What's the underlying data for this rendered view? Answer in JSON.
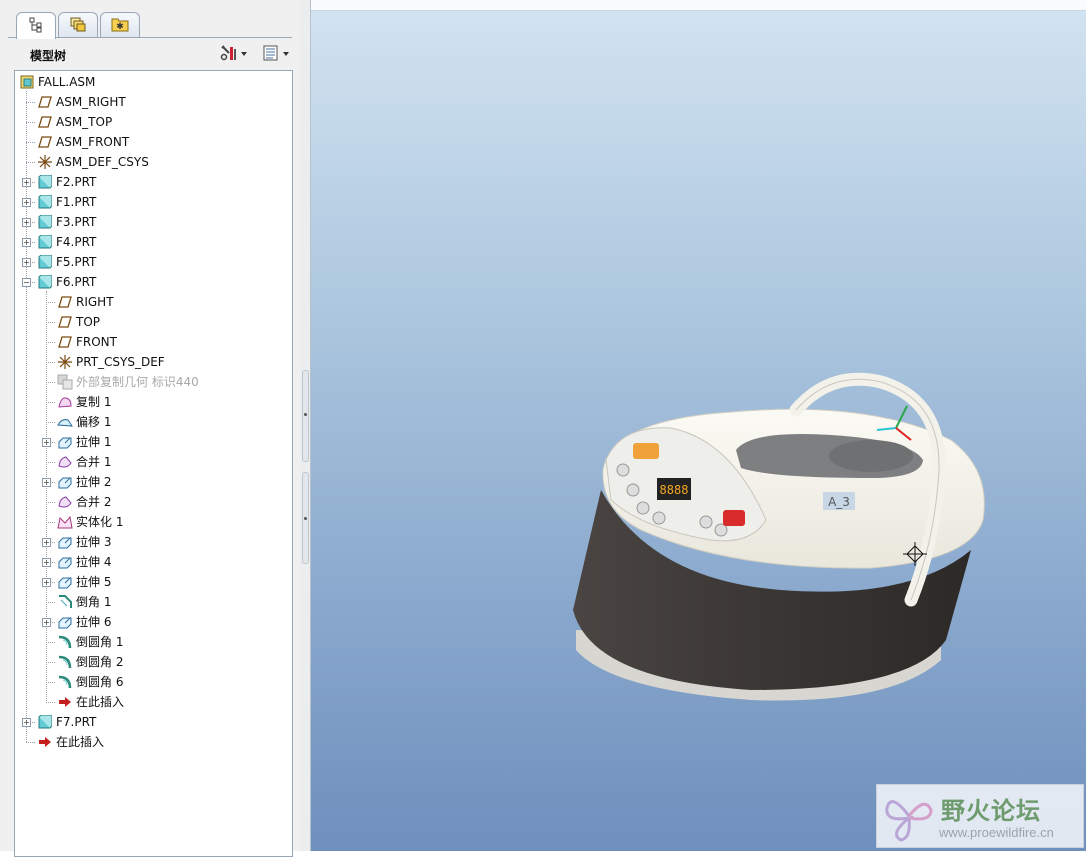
{
  "panel": {
    "tabs": [
      {
        "name": "model-tree",
        "icon": "model-tree-icon",
        "active": true
      },
      {
        "name": "layers",
        "icon": "layers-icon",
        "active": false
      },
      {
        "name": "favorites",
        "icon": "favorites-folder-icon",
        "active": false
      }
    ],
    "title": "模型树",
    "settings_icon": "tools-icon",
    "show_icon": "list-view-icon"
  },
  "tree": {
    "root": {
      "label": "FALL.ASM",
      "icon": "assembly-icon"
    },
    "items": [
      {
        "label": "ASM_RIGHT",
        "icon": "datum-plane-icon"
      },
      {
        "label": "ASM_TOP",
        "icon": "datum-plane-icon"
      },
      {
        "label": "ASM_FRONT",
        "icon": "datum-plane-icon"
      },
      {
        "label": "ASM_DEF_CSYS",
        "icon": "coordinate-system-icon"
      },
      {
        "label": "F2.PRT",
        "icon": "part-icon",
        "expandable": true,
        "expanded": false
      },
      {
        "label": "F1.PRT",
        "icon": "part-icon",
        "expandable": true,
        "expanded": false
      },
      {
        "label": "F3.PRT",
        "icon": "part-icon",
        "expandable": true,
        "expanded": false
      },
      {
        "label": "F4.PRT",
        "icon": "part-icon",
        "expandable": true,
        "expanded": false
      },
      {
        "label": "F5.PRT",
        "icon": "part-icon",
        "expandable": true,
        "expanded": false
      },
      {
        "label": "F6.PRT",
        "icon": "part-icon",
        "expandable": true,
        "expanded": true
      }
    ],
    "f6_children": [
      {
        "label": "RIGHT",
        "icon": "datum-plane-icon"
      },
      {
        "label": "TOP",
        "icon": "datum-plane-icon"
      },
      {
        "label": "FRONT",
        "icon": "datum-plane-icon"
      },
      {
        "label": "PRT_CSYS_DEF",
        "icon": "coordinate-system-icon"
      },
      {
        "label": "外部复制几何 标识440",
        "icon": "external-copy-geometry-icon",
        "disabled": true
      },
      {
        "label": "复制 1",
        "icon": "copy-surface-icon"
      },
      {
        "label": "偏移 1",
        "icon": "offset-icon"
      },
      {
        "label": "拉伸 1",
        "icon": "extrude-icon",
        "expandable": true
      },
      {
        "label": "合并 1",
        "icon": "merge-icon"
      },
      {
        "label": "拉伸 2",
        "icon": "extrude-icon",
        "expandable": true
      },
      {
        "label": "合并 2",
        "icon": "merge-icon"
      },
      {
        "label": "实体化 1",
        "icon": "solidify-icon"
      },
      {
        "label": "拉伸 3",
        "icon": "extrude-icon",
        "expandable": true
      },
      {
        "label": "拉伸 4",
        "icon": "extrude-icon",
        "expandable": true
      },
      {
        "label": "拉伸 5",
        "icon": "extrude-icon",
        "expandable": true
      },
      {
        "label": "倒角 1",
        "icon": "chamfer-icon"
      },
      {
        "label": "拉伸 6",
        "icon": "extrude-icon",
        "expandable": true
      },
      {
        "label": "倒圆角 1",
        "icon": "round-icon"
      },
      {
        "label": "倒圆角 2",
        "icon": "round-icon"
      },
      {
        "label": "倒圆角 6",
        "icon": "round-icon"
      },
      {
        "label": "在此插入",
        "icon": "insert-here-arrow-icon"
      }
    ],
    "after": [
      {
        "label": "F7.PRT",
        "icon": "part-icon",
        "expandable": true,
        "expanded": false
      },
      {
        "label": "在此插入",
        "icon": "insert-here-arrow-icon"
      }
    ]
  },
  "viewport": {
    "model_label": "A_3",
    "background_top": "#d3e4f1",
    "background_bottom": "#6f8fbd"
  },
  "watermark": {
    "title": "野火论坛",
    "url": "www.proewildfire.cn"
  }
}
